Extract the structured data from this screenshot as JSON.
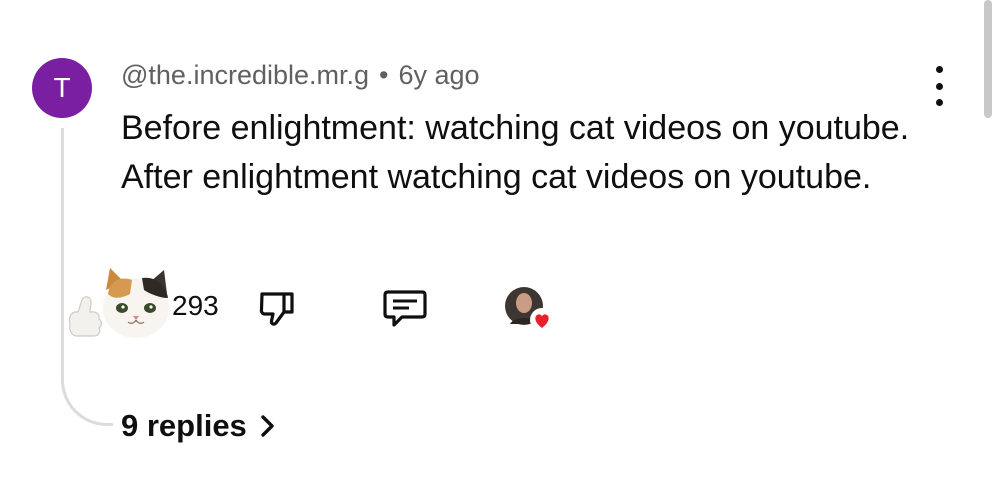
{
  "comment": {
    "avatar_letter": "T",
    "avatar_color": "#7b1fa2",
    "author": "@the.incredible.mr.g",
    "separator": "•",
    "time_ago": "6y ago",
    "text": "Before enlightment: watching cat videos on youtube. After enlightment watching cat videos on youtube.",
    "like_count": "293",
    "replies_label": "9 replies",
    "icons": {
      "like": "cat-thumbs-up-sticker",
      "dislike": "thumbs-down-icon",
      "reply": "comment-icon",
      "heart": "creator-heart-icon",
      "more": "more-vertical-icon",
      "replies": "chevron-right-icon"
    },
    "heart_color": "#e8202a"
  }
}
